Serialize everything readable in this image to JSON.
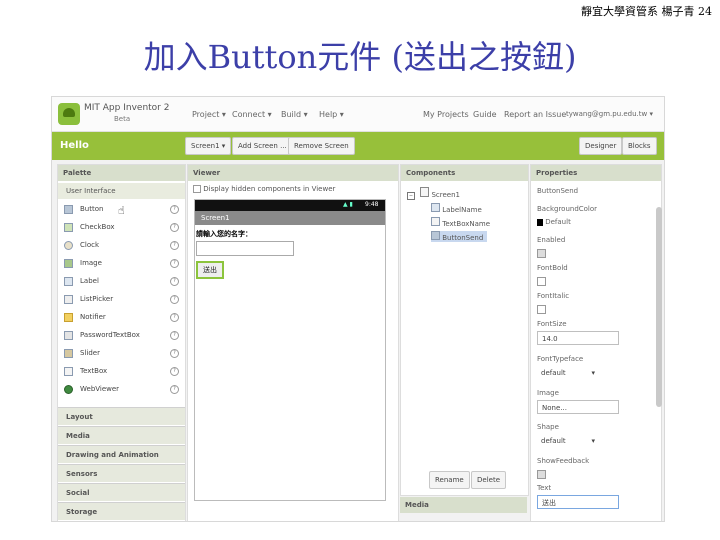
{
  "slide": {
    "header": "靜宜大學資管系 楊子青 24",
    "title": "加入Button元件 (送出之按鈕)"
  },
  "app": {
    "logo_title": "MIT App Inventor 2",
    "logo_sub": "Beta",
    "menu": [
      "Project ▾",
      "Connect ▾",
      "Build ▾",
      "Help ▾"
    ],
    "right_menu": [
      "My Projects",
      "Guide",
      "Report an Issue",
      "tywang@gm.pu.edu.tw ▾"
    ]
  },
  "toolbar": {
    "app_name": "Hello",
    "screen_select": "Screen1 ▾",
    "add_screen": "Add Screen ...",
    "remove_screen": "Remove Screen",
    "designer": "Designer",
    "blocks": "Blocks"
  },
  "palette": {
    "title": "Palette",
    "section": "User Interface",
    "items": [
      "Button",
      "CheckBox",
      "Clock",
      "Image",
      "Label",
      "ListPicker",
      "Notifier",
      "PasswordTextBox",
      "Slider",
      "TextBox",
      "WebViewer"
    ],
    "categories": [
      "Layout",
      "Media",
      "Drawing and Animation",
      "Sensors",
      "Social",
      "Storage"
    ]
  },
  "viewer": {
    "title": "Viewer",
    "hidden_checkbox": "Display hidden components in Viewer",
    "status_time": "9:48",
    "screen_title": "Screen1",
    "label_text": "請輸入您的名字：",
    "button_text": "送出"
  },
  "components": {
    "title": "Components",
    "items": [
      "Screen1",
      "LabelName",
      "TextBoxName",
      "ButtonSend"
    ],
    "rename": "Rename",
    "delete": "Delete",
    "media_title": "Media"
  },
  "properties": {
    "title": "Properties",
    "component": "ButtonSend",
    "background_label": "BackgroundColor",
    "background_value": "Default",
    "enabled_label": "Enabled",
    "fontbold_label": "FontBold",
    "fontitalic_label": "FontItalic",
    "fontsize_label": "FontSize",
    "fontsize_value": "14.0",
    "fonttypeface_label": "FontTypeface",
    "fonttypeface_value": "default",
    "image_label": "Image",
    "image_value": "None...",
    "shape_label": "Shape",
    "shape_value": "default",
    "showfeedback_label": "ShowFeedback",
    "text_label": "Text",
    "text_value": "送出"
  }
}
